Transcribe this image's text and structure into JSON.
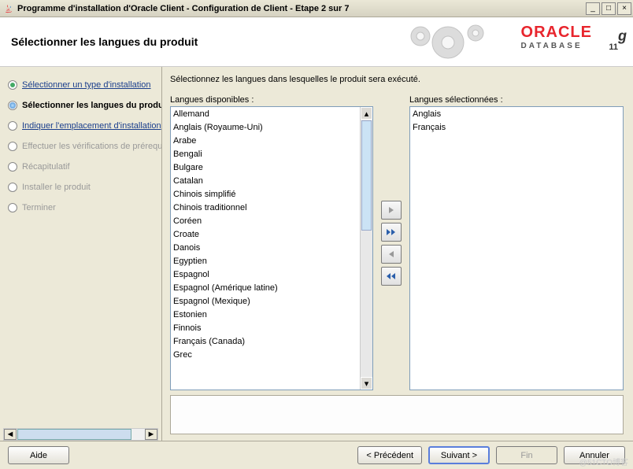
{
  "window": {
    "title": "Programme d'installation d'Oracle Client - Configuration de Client - Etape 2 sur 7"
  },
  "header": {
    "title": "Sélectionner les langues du produit",
    "brand": "ORACLE",
    "product": "DATABASE",
    "version": "11",
    "versionSuffix": "g"
  },
  "sidebar": {
    "steps": [
      {
        "label": "Sélectionner un type d'installation",
        "state": "completed",
        "link": true
      },
      {
        "label": "Sélectionner les langues du produit",
        "state": "current",
        "link": false
      },
      {
        "label": "Indiquer l'emplacement d'installation",
        "state": "pending",
        "link": true
      },
      {
        "label": "Effectuer les vérifications de prérequis",
        "state": "disabled",
        "link": false
      },
      {
        "label": "Récapitulatif",
        "state": "disabled",
        "link": false
      },
      {
        "label": "Installer le produit",
        "state": "disabled",
        "link": false
      },
      {
        "label": "Terminer",
        "state": "disabled",
        "link": false
      }
    ]
  },
  "main": {
    "instruction": "Sélectionnez les langues dans lesquelles le produit sera exécuté.",
    "availableLabel": "Langues disponibles :",
    "selectedLabel": "Langues sélectionnées :",
    "available": [
      "Allemand",
      "Anglais (Royaume-Uni)",
      "Arabe",
      "Bengali",
      "Bulgare",
      "Catalan",
      "Chinois simplifié",
      "Chinois traditionnel",
      "Coréen",
      "Croate",
      "Danois",
      "Egyptien",
      "Espagnol",
      "Espagnol (Amérique latine)",
      "Espagnol (Mexique)",
      "Estonien",
      "Finnois",
      "Français (Canada)",
      "Grec"
    ],
    "selected": [
      "Anglais",
      "Français"
    ]
  },
  "transfer": {
    "add": "›",
    "addAll": "»",
    "remove": "‹",
    "removeAll": "«"
  },
  "footer": {
    "help": "Aide",
    "back": "< Précédent",
    "next": "Suivant >",
    "finish": "Fin",
    "cancel": "Annuler"
  },
  "watermark": "@51CTO博客"
}
